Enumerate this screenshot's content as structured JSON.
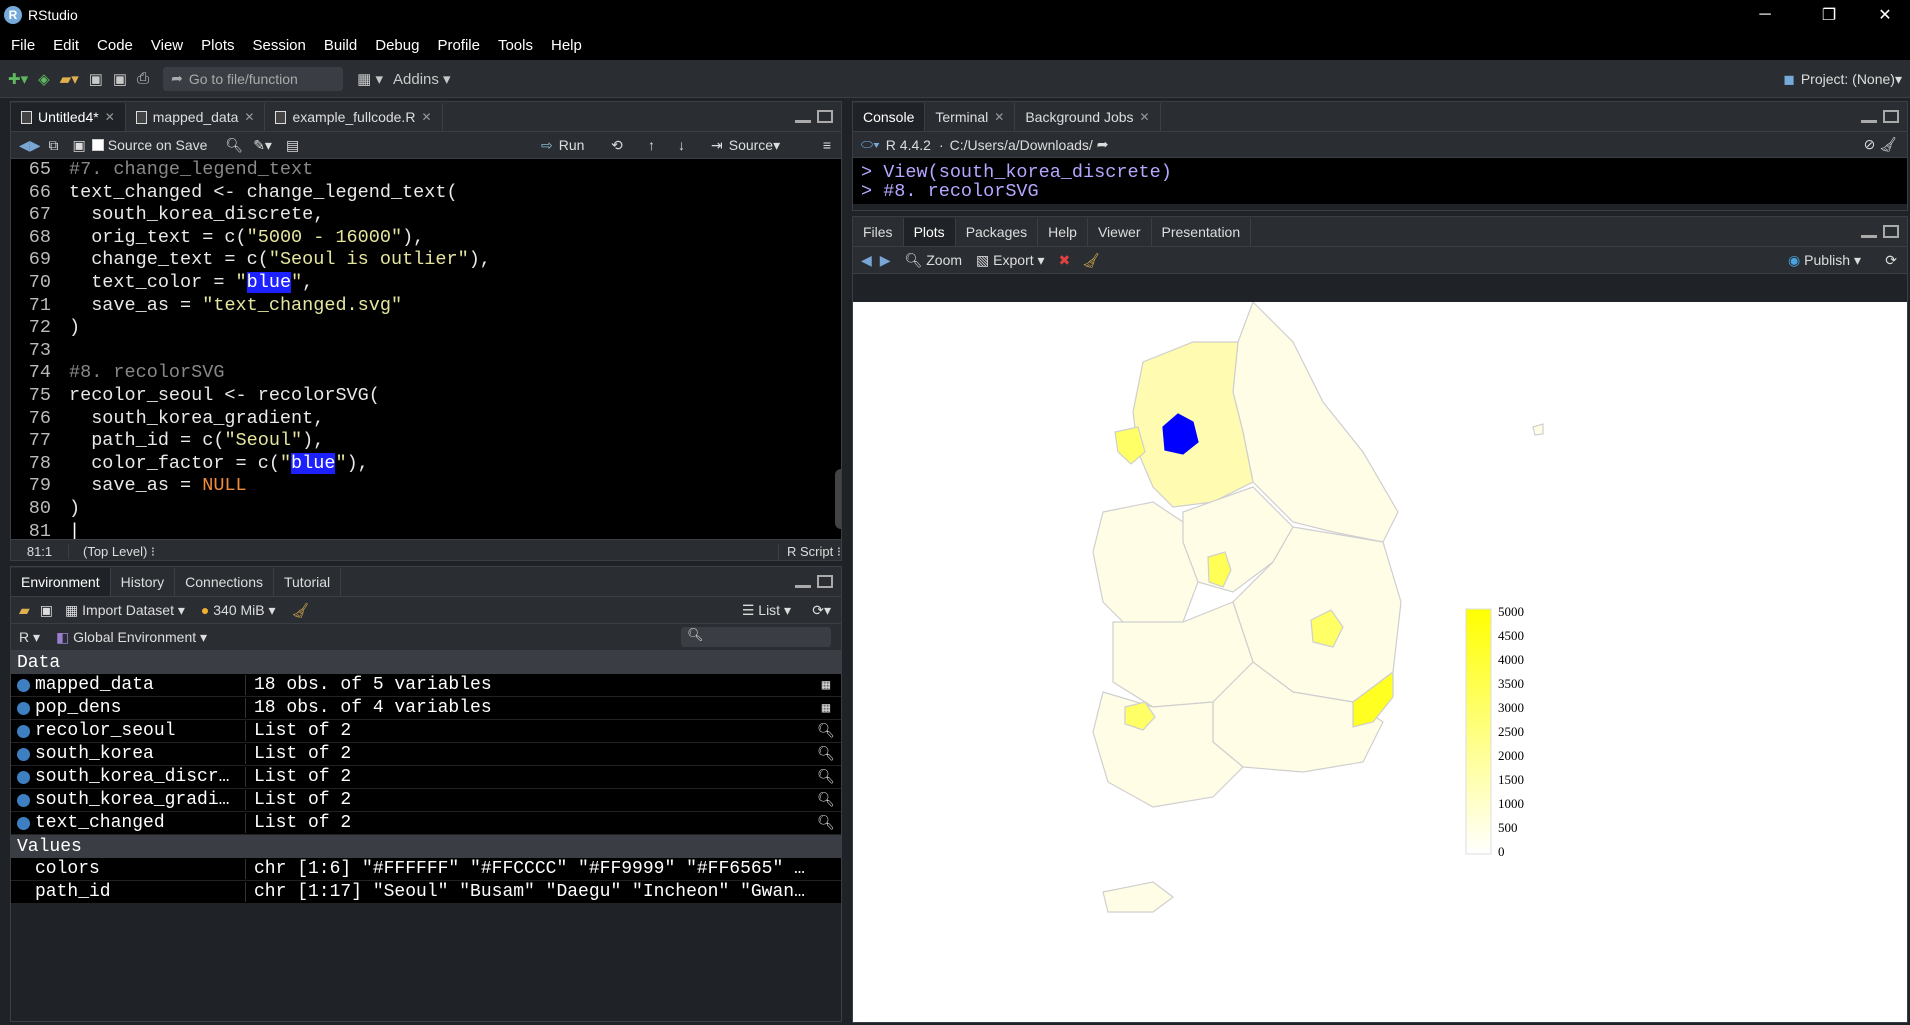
{
  "app": {
    "title": "RStudio"
  },
  "menu": [
    "File",
    "Edit",
    "Code",
    "View",
    "Plots",
    "Session",
    "Build",
    "Debug",
    "Profile",
    "Tools",
    "Help"
  ],
  "toolbar": {
    "goto_placeholder": "Go to file/function",
    "addins": "Addins",
    "project": "Project: (None)"
  },
  "editor": {
    "tabs": [
      "Untitled4*",
      "mapped_data",
      "example_fullcode.R"
    ],
    "source_on_save": "Source on Save",
    "run": "Run",
    "source": "Source",
    "position": "81:1",
    "scope": "(Top Level)",
    "filetype": "R Script",
    "lines": [
      {
        "n": "65",
        "parts": [
          [
            "cm",
            "#7. change_legend_text"
          ]
        ]
      },
      {
        "n": "66",
        "parts": [
          [
            "t",
            "text_changed <- change_legend_text("
          ]
        ]
      },
      {
        "n": "67",
        "parts": [
          [
            "t",
            "  south_korea_discrete,"
          ]
        ]
      },
      {
        "n": "68",
        "parts": [
          [
            "t",
            "  orig_text = c("
          ],
          [
            "str",
            "\"5000 - 16000\""
          ],
          [
            "t",
            "),"
          ]
        ]
      },
      {
        "n": "69",
        "parts": [
          [
            "t",
            "  change_text = c("
          ],
          [
            "str",
            "\"Seoul is outlier\""
          ],
          [
            "t",
            "),"
          ]
        ]
      },
      {
        "n": "70",
        "parts": [
          [
            "t",
            "  text_color = "
          ],
          [
            "str",
            "\""
          ],
          [
            "sel",
            "blue"
          ],
          [
            "str",
            "\""
          ],
          [
            "t",
            ","
          ]
        ]
      },
      {
        "n": "71",
        "parts": [
          [
            "t",
            "  save_as = "
          ],
          [
            "str",
            "\"text_changed.svg\""
          ]
        ]
      },
      {
        "n": "72",
        "parts": [
          [
            "t",
            ")"
          ]
        ]
      },
      {
        "n": "73",
        "parts": [
          [
            "t",
            ""
          ]
        ]
      },
      {
        "n": "74",
        "parts": [
          [
            "cm",
            "#8. recolorSVG"
          ]
        ]
      },
      {
        "n": "75",
        "parts": [
          [
            "t",
            "recolor_seoul <- recolorSVG("
          ]
        ]
      },
      {
        "n": "76",
        "parts": [
          [
            "t",
            "  south_korea_gradient,"
          ]
        ]
      },
      {
        "n": "77",
        "parts": [
          [
            "t",
            "  path_id = c("
          ],
          [
            "str",
            "\"Seoul\""
          ],
          [
            "t",
            "),"
          ]
        ]
      },
      {
        "n": "78",
        "parts": [
          [
            "t",
            "  color_factor = c("
          ],
          [
            "str",
            "\""
          ],
          [
            "sel",
            "blue"
          ],
          [
            "str",
            "\""
          ],
          [
            "t",
            "),"
          ]
        ]
      },
      {
        "n": "79",
        "parts": [
          [
            "t",
            "  save_as = "
          ],
          [
            "kw",
            "NULL"
          ]
        ]
      },
      {
        "n": "80",
        "parts": [
          [
            "t",
            ")"
          ]
        ]
      },
      {
        "n": "81",
        "parts": [
          [
            "t",
            ""
          ]
        ]
      }
    ]
  },
  "env": {
    "tabs": [
      "Environment",
      "History",
      "Connections",
      "Tutorial"
    ],
    "import": "Import Dataset",
    "memory": "340 MiB",
    "view_mode": "List",
    "lang": "R",
    "scope": "Global Environment",
    "data_header": "Data",
    "values_header": "Values",
    "data": [
      {
        "name": "mapped_data",
        "value": "18 obs. of 5 variables",
        "icon": "table"
      },
      {
        "name": "pop_dens",
        "value": "18 obs. of 4 variables",
        "icon": "table"
      },
      {
        "name": "recolor_seoul",
        "value": "List of  2",
        "icon": "search"
      },
      {
        "name": "south_korea",
        "value": "List of  2",
        "icon": "search"
      },
      {
        "name": "south_korea_discr…",
        "value": "List of  2",
        "icon": "search"
      },
      {
        "name": "south_korea_gradi…",
        "value": "List of  2",
        "icon": "search"
      },
      {
        "name": "text_changed",
        "value": "List of  2",
        "icon": "search"
      }
    ],
    "values": [
      {
        "name": "colors",
        "value": "chr [1:6] \"#FFFFFF\" \"#FFCCCC\" \"#FF9999\" \"#FF6565\" …"
      },
      {
        "name": "path_id",
        "value": "chr [1:17] \"Seoul\" \"Busam\" \"Daegu\" \"Incheon\" \"Gwan…"
      }
    ]
  },
  "console": {
    "tabs": [
      "Console",
      "Terminal",
      "Background Jobs"
    ],
    "rversion": "R 4.4.2",
    "path": "C:/Users/a/Downloads/",
    "lines": [
      "> View(south_korea_discrete)",
      "> #8. recolorSVG"
    ]
  },
  "plots": {
    "tabs": [
      "Files",
      "Plots",
      "Packages",
      "Help",
      "Viewer",
      "Presentation"
    ],
    "zoom": "Zoom",
    "export": "Export",
    "publish": "Publish",
    "legend": [
      "5000",
      "4500",
      "4000",
      "3500",
      "3000",
      "2500",
      "2000",
      "1500",
      "1000",
      "500",
      "0"
    ],
    "colors": {
      "highlight": "#0000ff",
      "high": "#ffff00",
      "low": "#fffde0"
    }
  }
}
